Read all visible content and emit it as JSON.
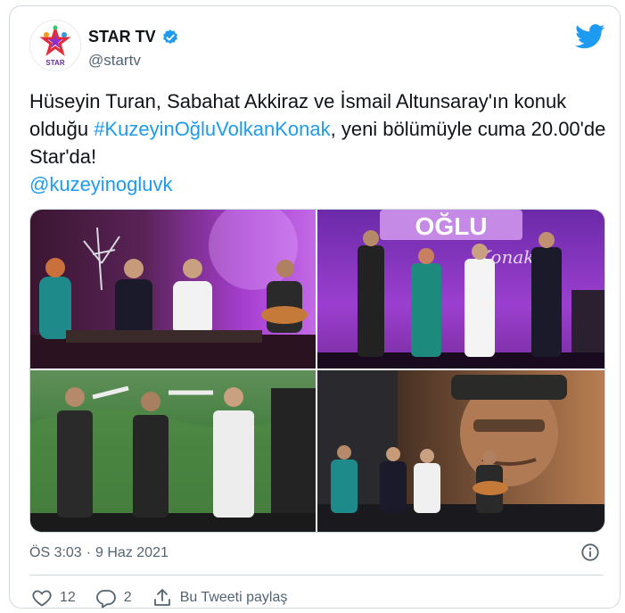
{
  "account": {
    "name": "STAR TV",
    "handle": "@startv",
    "logo_text": "STAR",
    "verified_icon": "verified-badge-icon"
  },
  "tweet": {
    "text_before": "Hüseyin Turan, Sabahat Akkiraz ve İsmail Altunsaray'ın konuk olduğu ",
    "hashtag": "#KuzeyinOğluVolkanKonak",
    "text_after": ", yeni bölümüyle cuma 20.00'de Star'da!",
    "mention": "@kuzeyinogluvk"
  },
  "media": {
    "count": 4,
    "sign_text": "OĞLU",
    "sign_script": "Konak"
  },
  "meta": {
    "time": "ÖS 3:03",
    "separator": "·",
    "date": "9 Haz 2021"
  },
  "actions": {
    "likes": "12",
    "replies": "2",
    "share_label": "Bu Tweeti paylaş"
  },
  "colors": {
    "link": "#1d9bf0",
    "muted": "#536471",
    "text": "#0f1419",
    "border": "#cfd9de"
  }
}
